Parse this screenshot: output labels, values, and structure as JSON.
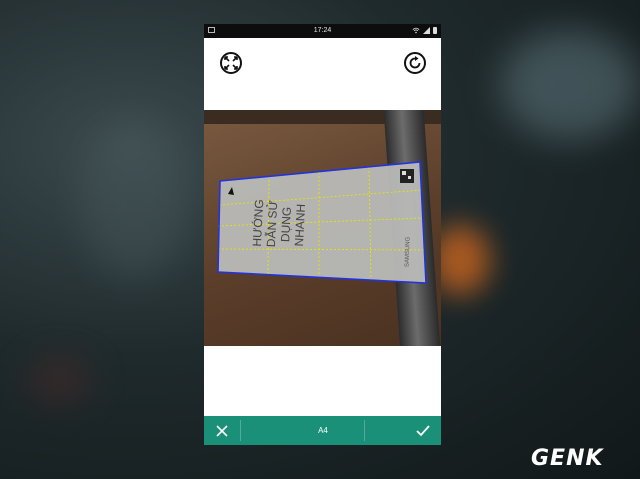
{
  "status_bar": {
    "time": "17:24",
    "icons": [
      "image-icon",
      "wifi-icon",
      "signal-icon",
      "battery-icon"
    ]
  },
  "toolbar": {
    "expand_icon": "expand-arrows-icon",
    "rotate_icon": "rotate-icon"
  },
  "document": {
    "title_lines": [
      "HƯỚNG",
      "DẪN SỬ",
      "DỤNG",
      "NHANH"
    ],
    "brand": "SAMSUNG",
    "crop_border_color": "#2233dd",
    "grid_color": "#e6e600"
  },
  "action_bar": {
    "cancel_icon": "close-icon",
    "paper_size": "A4",
    "confirm_icon": "check-icon",
    "color": "#1a9079"
  },
  "watermark": {
    "text": "GENK"
  }
}
